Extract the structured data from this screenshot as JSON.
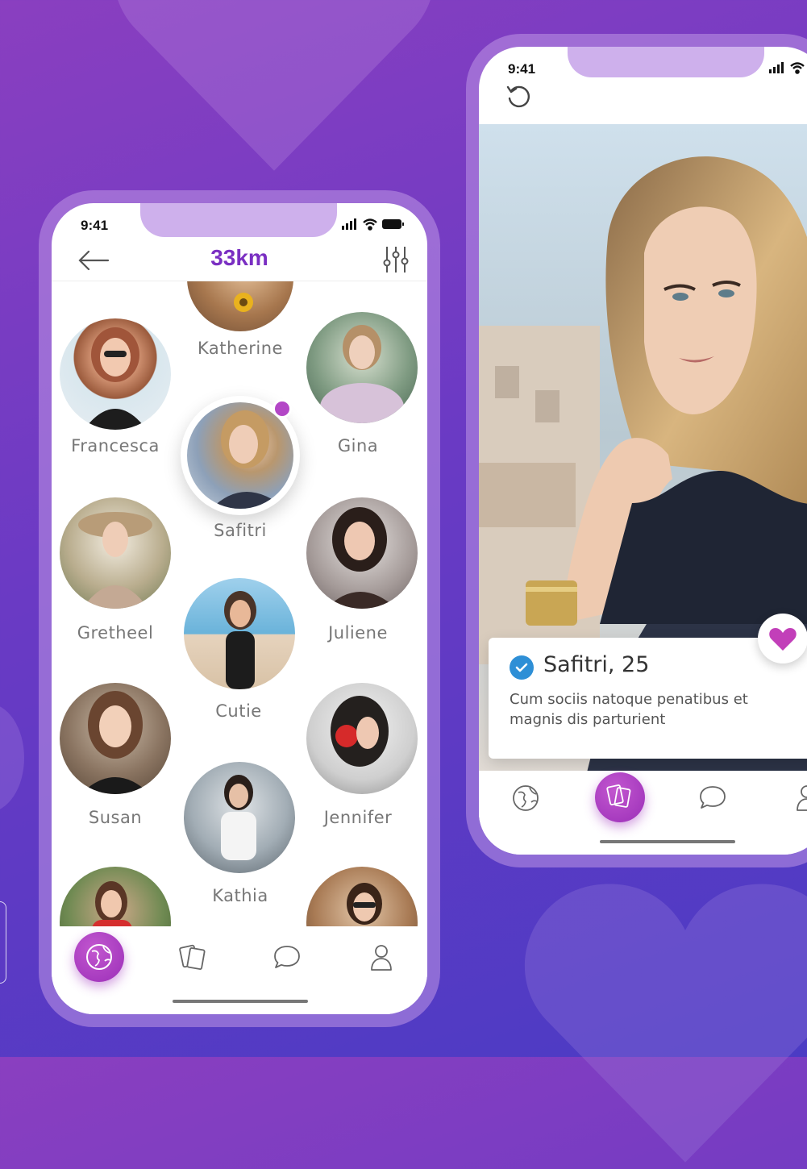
{
  "colors": {
    "accent": "#7a2fc2",
    "active_tab": "#a93abf",
    "verified": "#2e8fd6",
    "heart": "#c23fb9"
  },
  "left_phone": {
    "status": {
      "time": "9:41",
      "icons": [
        "signal-icon",
        "wifi-icon",
        "battery-icon"
      ]
    },
    "header": {
      "back_icon": "back-arrow-icon",
      "title": "33km",
      "filter_icon": "filter-sliders-icon"
    },
    "people": [
      {
        "name": "Katherine",
        "tone": "#b08050"
      },
      {
        "name": "Francesca",
        "tone": "#a06a55"
      },
      {
        "name": "Gina",
        "tone": "#6f8f7a"
      },
      {
        "name": "Safitri",
        "tone": "#8c9bb0",
        "online": true
      },
      {
        "name": "Gretheel",
        "tone": "#9a8a6c"
      },
      {
        "name": "Juliene",
        "tone": "#7a6a6a"
      },
      {
        "name": "Cutie",
        "tone": "#6aa6c8"
      },
      {
        "name": "Susan",
        "tone": "#7c6650"
      },
      {
        "name": "Jennifer",
        "tone": "#8a8a8a"
      },
      {
        "name": "Kathia",
        "tone": "#5c6670"
      },
      {
        "name": "",
        "tone": "#4d7a3e"
      },
      {
        "name": "",
        "tone": "#9a7050"
      }
    ],
    "tabs": [
      {
        "icon": "globe-icon",
        "active": true
      },
      {
        "icon": "cards-icon",
        "active": false
      },
      {
        "icon": "chat-icon",
        "active": false
      },
      {
        "icon": "user-icon",
        "active": false
      }
    ]
  },
  "right_phone": {
    "status": {
      "time": "9:41",
      "icons": [
        "signal-icon",
        "wifi-icon"
      ]
    },
    "header": {
      "undo_icon": "undo-icon"
    },
    "profile": {
      "name": "Safitri, 25",
      "description": "Cum sociis natoque penatibus et magnis dis parturient",
      "verified": true
    },
    "like_icon": "heart-icon",
    "tabs": [
      {
        "icon": "globe-icon",
        "active": false
      },
      {
        "icon": "cards-icon",
        "active": true
      },
      {
        "icon": "chat-icon",
        "active": false
      },
      {
        "icon": "user-icon",
        "active": false
      }
    ]
  }
}
